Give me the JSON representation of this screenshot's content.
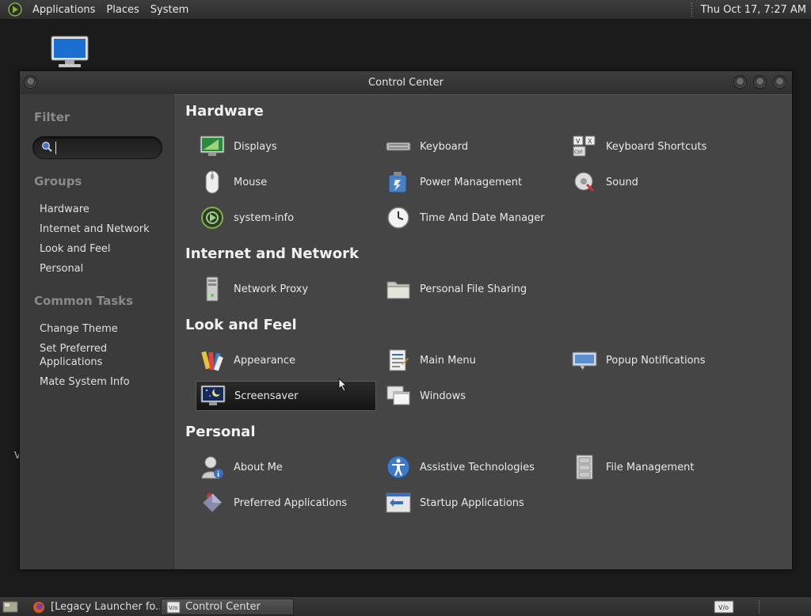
{
  "top_panel": {
    "menus": [
      "Applications",
      "Places",
      "System"
    ],
    "clock": "Thu Oct 17,  7:27 AM"
  },
  "window": {
    "title": "Control Center",
    "sidebar": {
      "filter_heading": "Filter",
      "search_value": "",
      "groups_heading": "Groups",
      "groups": [
        "Hardware",
        "Internet and Network",
        "Look and Feel",
        "Personal"
      ],
      "tasks_heading": "Common Tasks",
      "tasks": [
        "Change Theme",
        "Set Preferred Applications",
        "Mate System Info"
      ]
    },
    "sections": {
      "hardware": {
        "title": "Hardware",
        "items": [
          "Displays",
          "Keyboard",
          "Keyboard Shortcuts",
          "Mouse",
          "Power Management",
          "Sound",
          "system-info",
          "Time And Date Manager"
        ]
      },
      "internet": {
        "title": "Internet and Network",
        "items": [
          "Network Proxy",
          "Personal File Sharing"
        ]
      },
      "look": {
        "title": "Look and Feel",
        "items": [
          "Appearance",
          "Main Menu",
          "Popup Notifications",
          "Screensaver",
          "Windows"
        ]
      },
      "personal": {
        "title": "Personal",
        "items": [
          "About Me",
          "Assistive Technologies",
          "File Management",
          "Preferred Applications",
          "Startup Applications"
        ]
      }
    },
    "selected_item": "Screensaver"
  },
  "taskbar": {
    "tasks": [
      "[Legacy Launcher fo...",
      "Control Center"
    ],
    "active_task": "Control Center"
  },
  "desktop": {
    "stray_text": "V"
  },
  "colors": {
    "panel_bg": "#333333",
    "sidebar_bg": "#3b3b3b",
    "content_bg": "#454545",
    "accent": "#6a9e2c"
  }
}
